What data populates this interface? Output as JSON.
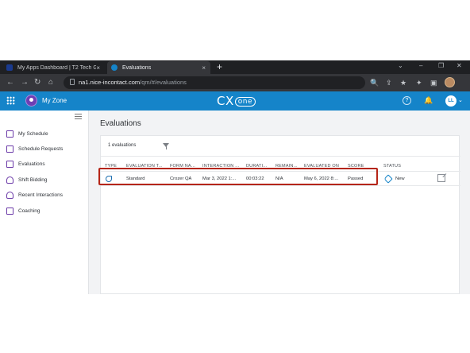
{
  "browser": {
    "tabs": [
      {
        "title": "My Apps Dashboard | T2 Tech Gr",
        "active": false,
        "favicon_color": "#1a3a8f"
      },
      {
        "title": "Evaluations",
        "active": true,
        "favicon_color": "#1584c9"
      }
    ],
    "new_tab": "+",
    "close_glyph": "×",
    "window_controls": {
      "dropdown": "⌄",
      "minimize": "–",
      "restore": "❐",
      "close": "✕"
    },
    "nav": {
      "back": "←",
      "forward": "→",
      "reload": "↻",
      "home": "⌂"
    },
    "url_host": "na1.nice-incontact.com",
    "url_path": "/qm/#/evaluations",
    "toolbar_icons": [
      "🔍",
      "⇪",
      "★",
      "✦",
      "▣"
    ]
  },
  "app": {
    "zone_title": "My Zone",
    "logo_main": "CX",
    "logo_sub": "one",
    "help_glyph": "?",
    "bell_glyph": "🔔",
    "user_initials": "LL",
    "user_chevron": "⌄",
    "accent_color": "#1584c9",
    "sidebar_icon_color": "#6b3aa8"
  },
  "sidebar": {
    "items": [
      {
        "label": "My Schedule",
        "icon": "calendar-icon"
      },
      {
        "label": "Schedule Requests",
        "icon": "schedule-requests-icon"
      },
      {
        "label": "Evaluations",
        "icon": "evaluations-icon"
      },
      {
        "label": "Shift Bidding",
        "icon": "shift-bidding-icon"
      },
      {
        "label": "Recent Interactions",
        "icon": "recent-interactions-icon"
      },
      {
        "label": "Coaching",
        "icon": "coaching-icon"
      }
    ]
  },
  "main": {
    "page_title": "Evaluations",
    "count_text": "1 evaluations",
    "columns": [
      "TYPE",
      "EVALUATION T...",
      "FORM NA...",
      "INTERACTION ...",
      "DURATI...",
      "REMAIN...",
      "EVALUATED ON",
      "SCORE",
      "STATUS"
    ],
    "rows": [
      {
        "type_icon": "phone-icon",
        "evaluation_type": "Standard",
        "form_name": "Crozer QA",
        "interaction": "Mar 3, 2022 1:...",
        "duration": "00:03:22",
        "remaining": "N/A",
        "evaluated_on": "May 6, 2022 8:...",
        "score": "Passed",
        "status": "New"
      }
    ],
    "highlight_color": "#b52517"
  }
}
